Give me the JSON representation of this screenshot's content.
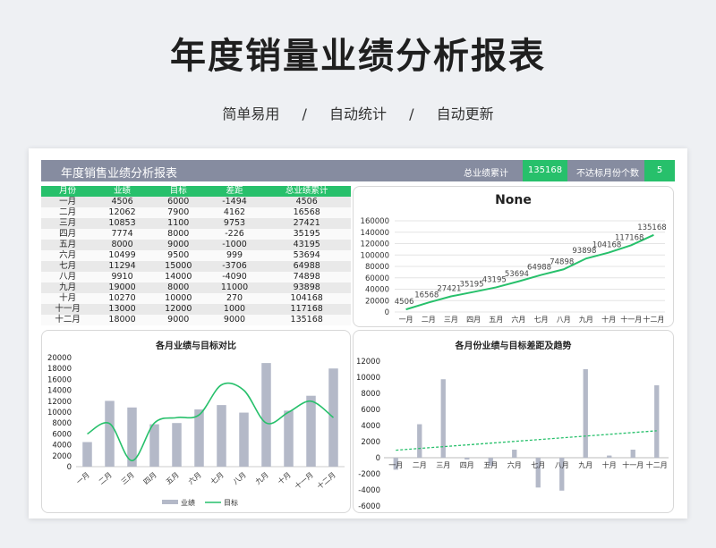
{
  "page": {
    "title": "年度销量业绩分析报表",
    "features": [
      "简单易用",
      "自动统计",
      "自动更新"
    ],
    "separator": "/"
  },
  "report": {
    "title": "年度销售业绩分析报表",
    "total_label": "总业绩累计",
    "total_value": "135168",
    "miss_label": "不达标月份个数",
    "miss_value": "5"
  },
  "table": {
    "headers": [
      "月份",
      "业绩",
      "目标",
      "差距",
      "总业绩累计"
    ],
    "rows": [
      [
        "一月",
        "4506",
        "6000",
        "-1494",
        "4506"
      ],
      [
        "二月",
        "12062",
        "7900",
        "4162",
        "16568"
      ],
      [
        "三月",
        "10853",
        "1100",
        "9753",
        "27421"
      ],
      [
        "四月",
        "7774",
        "8000",
        "-226",
        "35195"
      ],
      [
        "五月",
        "8000",
        "9000",
        "-1000",
        "43195"
      ],
      [
        "六月",
        "10499",
        "9500",
        "999",
        "53694"
      ],
      [
        "七月",
        "11294",
        "15000",
        "-3706",
        "64988"
      ],
      [
        "八月",
        "9910",
        "14000",
        "-4090",
        "74898"
      ],
      [
        "九月",
        "19000",
        "8000",
        "11000",
        "93898"
      ],
      [
        "十月",
        "10270",
        "10000",
        "270",
        "104168"
      ],
      [
        "十一月",
        "13000",
        "12000",
        "1000",
        "117168"
      ],
      [
        "十二月",
        "18000",
        "9000",
        "9000",
        "135168"
      ]
    ]
  },
  "colors": {
    "accent": "#27c06b",
    "header": "#868ca0",
    "bar": "#b4b9c8",
    "line": "#27c06b"
  },
  "chart_data": [
    {
      "type": "line",
      "title": "None",
      "categories": [
        "一月",
        "二月",
        "三月",
        "四月",
        "五月",
        "六月",
        "七月",
        "八月",
        "九月",
        "十月",
        "十一月",
        "十二月"
      ],
      "series": [
        {
          "values": [
            4506,
            16568,
            27421,
            35195,
            43195,
            53694,
            64988,
            74898,
            93898,
            104168,
            117168,
            135168
          ]
        }
      ],
      "ylim": [
        0,
        160000
      ],
      "yticks": [
        0,
        20000,
        40000,
        60000,
        80000,
        100000,
        120000,
        140000,
        160000
      ],
      "data_labels": true,
      "grid": true
    },
    {
      "type": "bar",
      "title": "各月业绩与目标对比",
      "categories": [
        "一月",
        "二月",
        "三月",
        "四月",
        "五月",
        "六月",
        "七月",
        "八月",
        "九月",
        "十月",
        "十一月",
        "十二月"
      ],
      "series": [
        {
          "name": "业绩",
          "type": "bar",
          "values": [
            4506,
            12062,
            10853,
            7774,
            8000,
            10499,
            11294,
            9910,
            19000,
            10270,
            13000,
            18000
          ]
        },
        {
          "name": "目标",
          "type": "line",
          "values": [
            6000,
            7900,
            1100,
            8000,
            9000,
            9500,
            15000,
            14000,
            8000,
            10000,
            12000,
            9000
          ]
        }
      ],
      "ylim": [
        0,
        20000
      ],
      "yticks": [
        0,
        2000,
        4000,
        6000,
        8000,
        10000,
        12000,
        14000,
        16000,
        18000,
        20000
      ],
      "legend": "bottom"
    },
    {
      "type": "bar",
      "title": "各月份业绩与目标差距及趋势",
      "categories": [
        "一月",
        "二月",
        "三月",
        "四月",
        "五月",
        "六月",
        "七月",
        "八月",
        "九月",
        "十月",
        "十一月",
        "十二月"
      ],
      "series": [
        {
          "values": [
            -1494,
            4162,
            9753,
            -226,
            -1000,
            999,
            -3706,
            -4090,
            11000,
            270,
            1000,
            9000
          ]
        }
      ],
      "trendline": "linear",
      "ylim": [
        -6000,
        12000
      ],
      "yticks": [
        -6000,
        -4000,
        -2000,
        0,
        2000,
        4000,
        6000,
        8000,
        10000,
        12000
      ]
    }
  ]
}
